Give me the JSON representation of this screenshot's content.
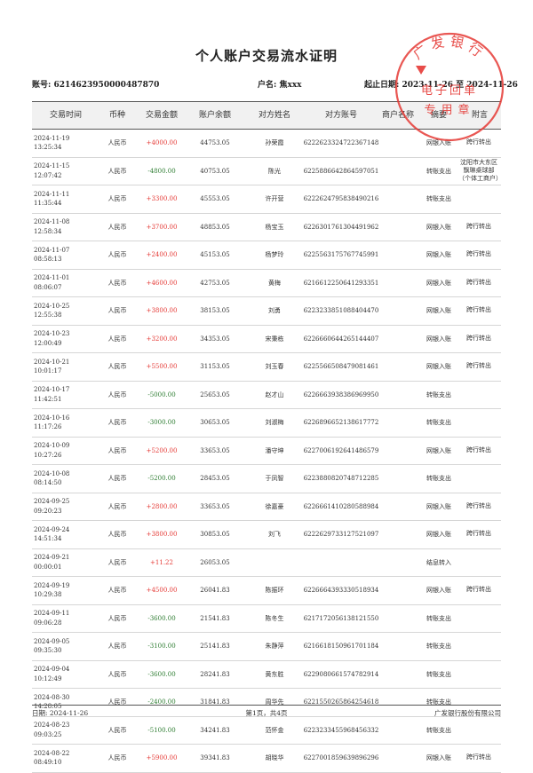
{
  "document": {
    "title": "个人账户交易流水证明",
    "account_label": "账号: 6214623950000487870",
    "name_label": "户名: 焦xxx",
    "period_label": "起止日期: 2023-11-26 至 2024-11-26"
  },
  "table": {
    "headers": [
      "交易时间",
      "币种",
      "交易金额",
      "账户余额",
      "对方姓名",
      "对方账号",
      "商户名称",
      "摘要",
      "附言"
    ],
    "rows": [
      {
        "time": "2024-11-19 13:25:34",
        "currency": "人民币",
        "amount": "+4000.00",
        "balance": "44753.05",
        "cp_name": "孙荣霞",
        "cp_account": "6222623324722367148",
        "merchant": "",
        "summary": "网银入账",
        "note": "跨行转出"
      },
      {
        "time": "2024-11-15 12:07:42",
        "currency": "人民币",
        "amount": "-4800.00",
        "balance": "40753.05",
        "cp_name": "陈光",
        "cp_account": "6225886642864597051",
        "merchant": "",
        "summary": "转账支出",
        "note": "沈阳市大东区飘琳桌球部（个体工商户）"
      },
      {
        "time": "2024-11-11 11:35:44",
        "currency": "人民币",
        "amount": "+3300.00",
        "balance": "45553.05",
        "cp_name": "许开营",
        "cp_account": "6222624795838490216",
        "merchant": "",
        "summary": "转账支出",
        "note": ""
      },
      {
        "time": "2024-11-08 12:58:34",
        "currency": "人民币",
        "amount": "+3700.00",
        "balance": "48853.05",
        "cp_name": "杨宝玉",
        "cp_account": "6226301761304491962",
        "merchant": "",
        "summary": "网银入账",
        "note": "跨行转出"
      },
      {
        "time": "2024-11-07 08:58:13",
        "currency": "人民币",
        "amount": "+2400.00",
        "balance": "45153.05",
        "cp_name": "杨梦玲",
        "cp_account": "6225563175767745991",
        "merchant": "",
        "summary": "网银入账",
        "note": "跨行转出"
      },
      {
        "time": "2024-11-01 08:06:07",
        "currency": "人民币",
        "amount": "+4600.00",
        "balance": "42753.05",
        "cp_name": "黄梅",
        "cp_account": "6216612250641293351",
        "merchant": "",
        "summary": "网银入账",
        "note": "跨行转出"
      },
      {
        "time": "2024-10-25 12:55:38",
        "currency": "人民币",
        "amount": "+3800.00",
        "balance": "38153.05",
        "cp_name": "刘勇",
        "cp_account": "6223233851088404470",
        "merchant": "",
        "summary": "网银入账",
        "note": "跨行转出"
      },
      {
        "time": "2024-10-23 12:00:49",
        "currency": "人民币",
        "amount": "+3200.00",
        "balance": "34353.05",
        "cp_name": "宋秉栋",
        "cp_account": "6226660644265144407",
        "merchant": "",
        "summary": "网银入账",
        "note": "跨行转出"
      },
      {
        "time": "2024-10-21 10:01:17",
        "currency": "人民币",
        "amount": "+5500.00",
        "balance": "31153.05",
        "cp_name": "刘玉春",
        "cp_account": "6225566508479081461",
        "merchant": "",
        "summary": "网银入账",
        "note": "跨行转出"
      },
      {
        "time": "2024-10-17 11:42:51",
        "currency": "人民币",
        "amount": "-5000.00",
        "balance": "25653.05",
        "cp_name": "赵才山",
        "cp_account": "6226663938386969950",
        "merchant": "",
        "summary": "转账支出",
        "note": ""
      },
      {
        "time": "2024-10-16 11:17:26",
        "currency": "人民币",
        "amount": "-3000.00",
        "balance": "30653.05",
        "cp_name": "刘淑梅",
        "cp_account": "6226896652138617772",
        "merchant": "",
        "summary": "转账支出",
        "note": ""
      },
      {
        "time": "2024-10-09 10:27:26",
        "currency": "人民币",
        "amount": "+5200.00",
        "balance": "33653.05",
        "cp_name": "潘守坤",
        "cp_account": "6227006192641486579",
        "merchant": "",
        "summary": "网银入账",
        "note": "跨行转出"
      },
      {
        "time": "2024-10-08 08:14:50",
        "currency": "人民币",
        "amount": "-5200.00",
        "balance": "28453.05",
        "cp_name": "于凤智",
        "cp_account": "6223880820748712285",
        "merchant": "",
        "summary": "转账支出",
        "note": ""
      },
      {
        "time": "2024-09-25 09:20:23",
        "currency": "人民币",
        "amount": "+2800.00",
        "balance": "33653.05",
        "cp_name": "徐嘉豪",
        "cp_account": "6226661410280588984",
        "merchant": "",
        "summary": "网银入账",
        "note": "跨行转出"
      },
      {
        "time": "2024-09-24 14:51:34",
        "currency": "人民币",
        "amount": "+3800.00",
        "balance": "30853.05",
        "cp_name": "刘飞",
        "cp_account": "6222629733127521097",
        "merchant": "",
        "summary": "网银入账",
        "note": "跨行转出"
      },
      {
        "time": "2024-09-21 00:00:01",
        "currency": "人民币",
        "amount": "+11.22",
        "balance": "26053.05",
        "cp_name": "",
        "cp_account": "",
        "merchant": "",
        "summary": "结息转入",
        "note": ""
      },
      {
        "time": "2024-09-19 10:29:38",
        "currency": "人民币",
        "amount": "+4500.00",
        "balance": "26041.83",
        "cp_name": "陈振环",
        "cp_account": "6226664393330518934",
        "merchant": "",
        "summary": "网银入账",
        "note": "跨行转出"
      },
      {
        "time": "2024-09-11 09:06:28",
        "currency": "人民币",
        "amount": "-3600.00",
        "balance": "21541.83",
        "cp_name": "陈冬生",
        "cp_account": "6217172056138121550",
        "merchant": "",
        "summary": "转账支出",
        "note": ""
      },
      {
        "time": "2024-09-05 09:35:30",
        "currency": "人民币",
        "amount": "-3100.00",
        "balance": "25141.83",
        "cp_name": "朱静萍",
        "cp_account": "6216618150961701184",
        "merchant": "",
        "summary": "转账支出",
        "note": ""
      },
      {
        "time": "2024-09-04 10:12:49",
        "currency": "人民币",
        "amount": "-3600.00",
        "balance": "28241.83",
        "cp_name": "黄东胜",
        "cp_account": "6229080661574782914",
        "merchant": "",
        "summary": "转账支出",
        "note": ""
      },
      {
        "time": "2024-08-30 14:28:05",
        "currency": "人民币",
        "amount": "-2400.00",
        "balance": "31841.83",
        "cp_name": "周华先",
        "cp_account": "6221550265864254618",
        "merchant": "",
        "summary": "转账支出",
        "note": ""
      },
      {
        "time": "2024-08-23 09:03:25",
        "currency": "人民币",
        "amount": "-5100.00",
        "balance": "34241.83",
        "cp_name": "范怀金",
        "cp_account": "6223233455968456332",
        "merchant": "",
        "summary": "转账支出",
        "note": ""
      },
      {
        "time": "2024-08-22 08:49:10",
        "currency": "人民币",
        "amount": "+5900.00",
        "balance": "39341.83",
        "cp_name": "胡晓华",
        "cp_account": "6227001859639896296",
        "merchant": "",
        "summary": "网银入账",
        "note": "跨行转出"
      }
    ]
  },
  "footer": {
    "date": "日期: 2024-11-26",
    "page": "第1页，共4页",
    "bank": "广发银行股份有限公司"
  },
  "seal": {
    "bank_name": "广发银行",
    "line1": "电子回单",
    "line2": "专用章",
    "color": "#e53935"
  },
  "colors": {
    "income": "#e53935",
    "expense": "#2e7d32"
  }
}
